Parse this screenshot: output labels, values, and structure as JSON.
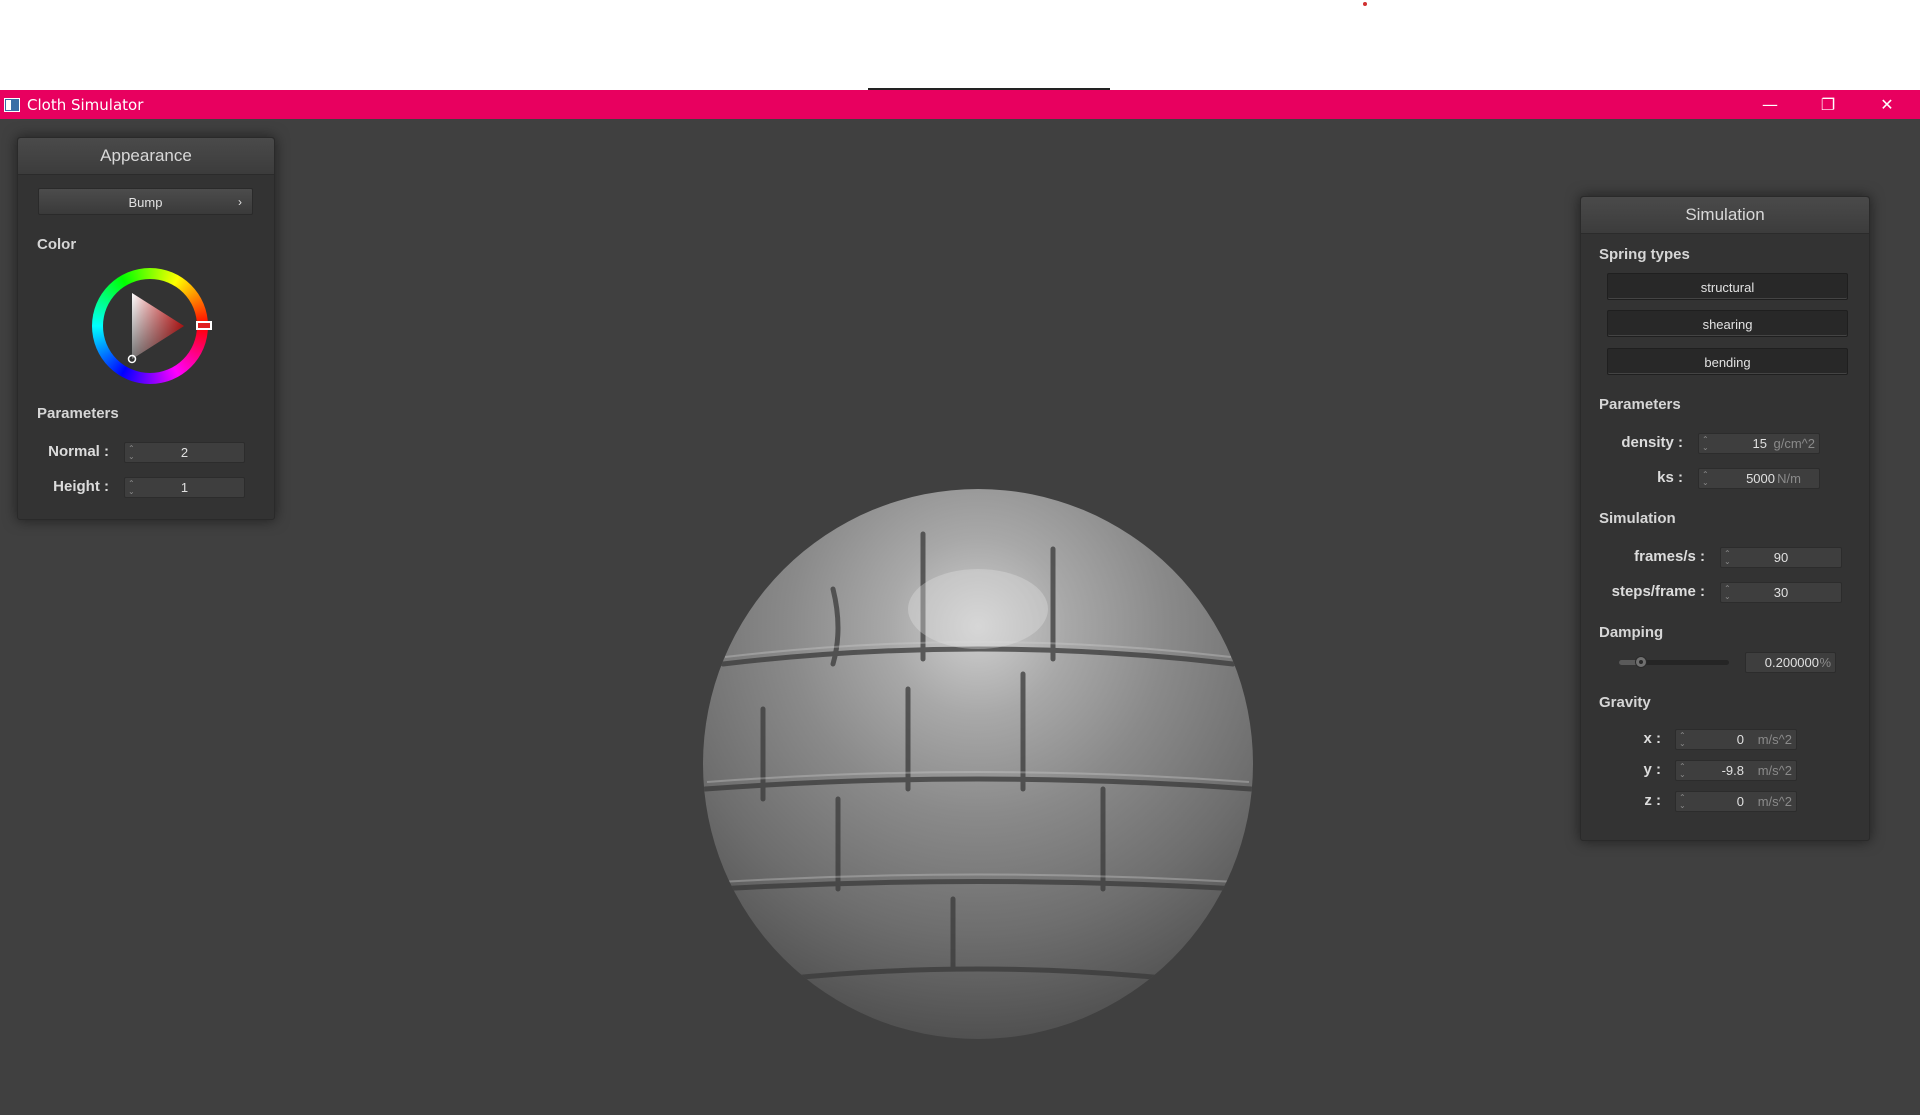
{
  "window": {
    "title": "Cloth Simulator",
    "minimize_glyph": "—",
    "restore_glyph": "❐",
    "close_glyph": "✕"
  },
  "appearance": {
    "title": "Appearance",
    "mode_value": "Bump",
    "mode_chevron": "›",
    "color_label": "Color",
    "parameters_label": "Parameters",
    "normal_label": "Normal :",
    "normal_value": "2",
    "height_label": "Height :",
    "height_value": "1",
    "selected_color": "#e02020"
  },
  "simulation": {
    "title": "Simulation",
    "spring_types_label": "Spring types",
    "springs": [
      "structural",
      "shearing",
      "bending"
    ],
    "parameters_label": "Parameters",
    "density_label": "density :",
    "density_value": "15",
    "density_unit": "g/cm^2",
    "ks_label": "ks :",
    "ks_value": "5000",
    "ks_unit": "N/m",
    "simulation_label": "Simulation",
    "fps_label": "frames/s :",
    "fps_value": "90",
    "steps_label": "steps/frame :",
    "steps_value": "30",
    "damping_label": "Damping",
    "damping_value": "0.200000",
    "damping_unit": "%",
    "damping_fraction": 0.2,
    "gravity_label": "Gravity",
    "gx_label": "x :",
    "gx_value": "0",
    "gy_label": "y :",
    "gy_value": "-9.8",
    "gz_label": "z :",
    "gz_value": "0",
    "g_unit": "m/s^2"
  },
  "colors": {
    "titlebar": "#e8005f",
    "viewport": "#404040",
    "panel": "#333333"
  }
}
